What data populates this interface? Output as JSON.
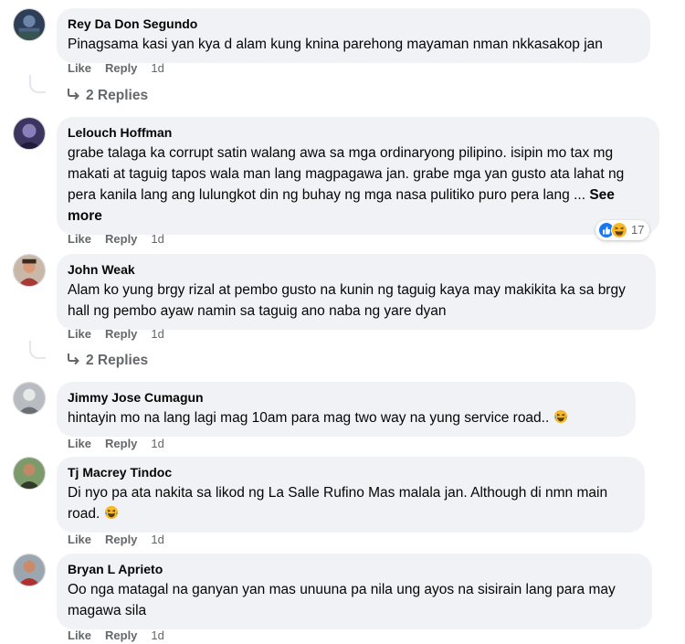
{
  "comments": [
    {
      "author": "Rey Da Don Segundo",
      "text": "Pinagsama kasi yan kya d alam kung knina parehong mayaman nman nkkasakop jan",
      "like": "Like",
      "reply": "Reply",
      "time": "1d",
      "replies_label": "2 Replies"
    },
    {
      "author": "Lelouch Hoffman",
      "text": "grabe talaga ka corrupt satin walang awa sa mga ordinaryong pilipino. isipin mo tax mg makati at taguig tapos wala man lang magpagawa jan. grabe mga yan gusto ata lahat ng pera kanila lang ang lulungkot din ng buhay ng mga nasa pulitiko puro pera lang ...",
      "see_more": "See more",
      "like": "Like",
      "reply": "Reply",
      "time": "1d",
      "reaction_count": "17",
      "reaction_icons": [
        "like-reaction-icon",
        "haha-reaction-icon"
      ]
    },
    {
      "author": "John Weak",
      "text": "Alam ko yung brgy rizal at pembo gusto na kunin ng taguig kaya may makikita ka sa brgy hall ng pembo ayaw namin sa taguig ano naba ng yare dyan",
      "like": "Like",
      "reply": "Reply",
      "time": "1d",
      "replies_label": "2 Replies"
    },
    {
      "author": "Jimmy Jose Cumagun",
      "text": "hintayin mo na lang lagi mag 10am para mag two way na yung service road..",
      "like": "Like",
      "reply": "Reply",
      "time": "1d"
    },
    {
      "author": "Tj Macrey Tindoc",
      "text": "Di nyo pa ata nakita sa likod ng La Salle Rufino Mas malala jan. Although di nmn main road.",
      "like": "Like",
      "reply": "Reply",
      "time": "1d"
    },
    {
      "author": "Bryan L Aprieto",
      "text": "Oo nga matagal na ganyan yan mas unuuna pa nila ung ayos na sisirain lang para may magawa sila",
      "like": "Like",
      "reply": "Reply",
      "time": "1d"
    }
  ],
  "colors": {
    "bubble": "#f0f2f5",
    "secondary_text": "#65676b",
    "like_blue": "#1877f2",
    "haha_yellow": "#f7b928"
  }
}
